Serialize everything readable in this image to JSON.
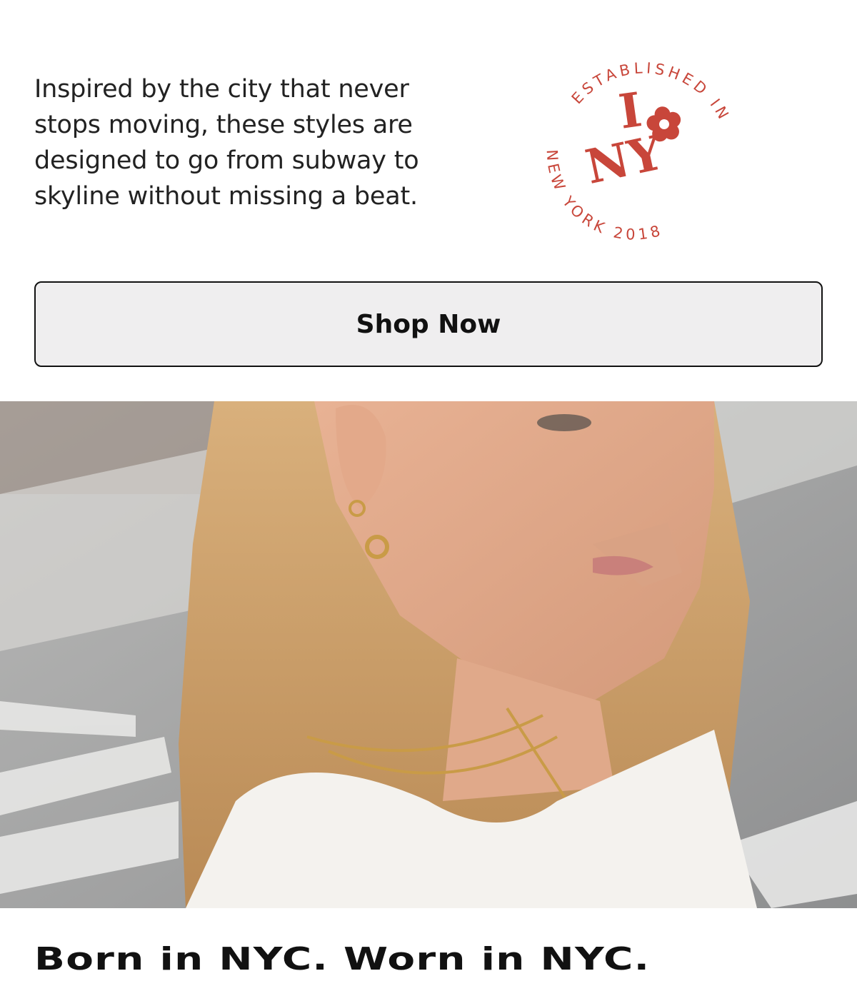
{
  "intro": {
    "text": "Inspired by the city that never stops moving, these styles are designed to go from subway to skyline without missing a beat."
  },
  "stamp": {
    "top_arc": "ESTABLISHED IN",
    "bottom_arc": "NEW YORK 2018",
    "center_line1": "I",
    "center_line2": "NY",
    "color": "#c8463a"
  },
  "cta": {
    "label": "Shop Now"
  },
  "hero": {
    "alt": "Woman with blonde hair wearing gold earrings and layered necklaces"
  },
  "tagline": {
    "text": "Born in NYC. Worn in NYC."
  }
}
